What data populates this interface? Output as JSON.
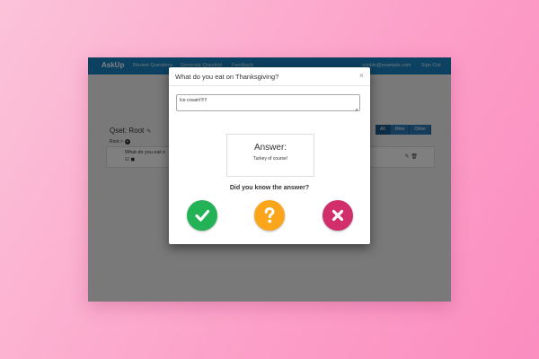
{
  "navbar": {
    "brand": "AskUp",
    "links": [
      "Review Questions",
      "Generate Question",
      "Feedback"
    ],
    "email": "sunbin@example.com",
    "signout": "Sign Out"
  },
  "page": {
    "qset_title": "Qset: Root",
    "breadcrumb": "Root >",
    "question_text": "What do you eat o",
    "filters": [
      "All",
      "Mine",
      "Other"
    ],
    "active_filter": "All"
  },
  "modal": {
    "title": "What do you eat on Thanksgiving?",
    "input_value": "Ice cream!!!!!!",
    "answer_heading": "Answer:",
    "answer_text": "Turkey of course!",
    "prompt": "Did you know the answer?",
    "buttons": {
      "yes_icon": "check-icon",
      "maybe_icon": "question-icon",
      "no_icon": "x-icon"
    }
  },
  "colors": {
    "navbar": "#1a83c4",
    "yes": "#24b257",
    "maybe": "#fba51a",
    "no": "#d12e6c"
  }
}
